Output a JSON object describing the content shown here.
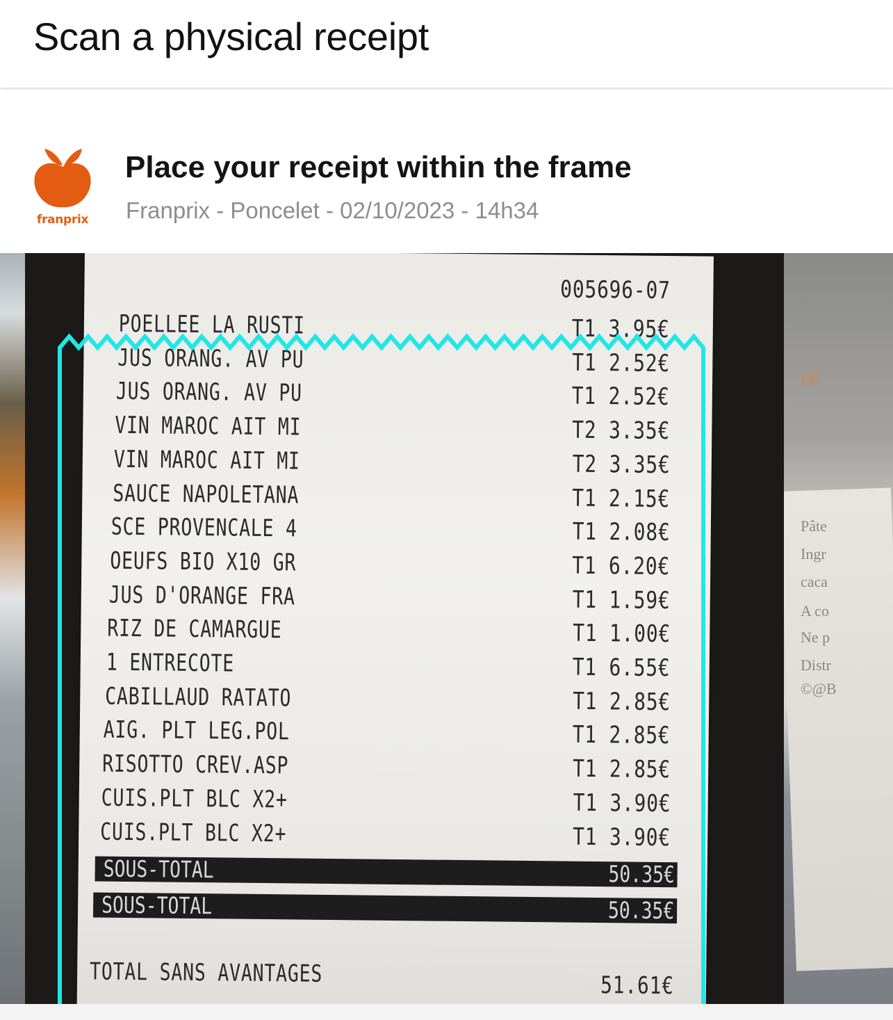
{
  "header": {
    "title": "Scan a physical receipt"
  },
  "info": {
    "logo_text": "franprix",
    "instruction": "Place your receipt within the frame",
    "store_meta": "Franprix - Poncelet - 02/10/2023 - 14h34"
  },
  "colors": {
    "frame": "#22e6e6",
    "brand": "#e06010"
  },
  "background_text": [
    "ré",
    "Pâte",
    "Ingr",
    "caca",
    "A co",
    "Ne p",
    "Distr",
    "©@B"
  ],
  "receipt": {
    "ticket_no": "005696-07",
    "items": [
      {
        "name": "POELLEE LA RUSTI",
        "price": "T1 3.95€"
      },
      {
        "name": "JUS ORANG. AV PU",
        "price": "T1 2.52€"
      },
      {
        "name": "JUS ORANG. AV PU",
        "price": "T1 2.52€"
      },
      {
        "name": "VIN MAROC AIT MI",
        "price": "T2 3.35€"
      },
      {
        "name": "VIN MAROC AIT MI",
        "price": "T2 3.35€"
      },
      {
        "name": "SAUCE NAPOLETANA",
        "price": "T1 2.15€"
      },
      {
        "name": "SCE PROVENCALE 4",
        "price": "T1 2.08€"
      },
      {
        "name": "OEUFS BIO X10 GR",
        "price": "T1 6.20€"
      },
      {
        "name": "JUS D'ORANGE FRA",
        "price": "T1 1.59€"
      },
      {
        "name": "RIZ DE CAMARGUE",
        "price": "T1 1.00€"
      },
      {
        "name": "1 ENTRECOTE",
        "price": "T1 6.55€"
      },
      {
        "name": "CABILLAUD RATATO",
        "price": "T1 2.85€"
      },
      {
        "name": "AIG. PLT LEG.POL",
        "price": "T1 2.85€"
      },
      {
        "name": "RISOTTO CREV.ASP",
        "price": "T1 2.85€"
      },
      {
        "name": "CUIS.PLT BLC X2+",
        "price": "T1 3.90€"
      },
      {
        "name": "CUIS.PLT BLC X2+",
        "price": "T1 3.90€"
      }
    ],
    "subtotals": [
      {
        "label": "SOUS-TOTAL",
        "value": "50.35€"
      },
      {
        "label": "SOUS-TOTAL",
        "value": "50.35€"
      }
    ],
    "total": {
      "label": "TOTAL SANS AVANTAGES",
      "value": "51.61€"
    }
  }
}
